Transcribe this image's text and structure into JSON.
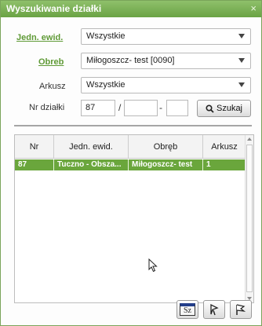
{
  "window": {
    "title": "Wyszukiwanie działki",
    "close_glyph": "×"
  },
  "form": {
    "jedn_label": "Jedn. ewid.",
    "jedn_value": "Wszystkie",
    "obreb_label": "Obreb",
    "obreb_value": "Miłogoszcz- test [0090]",
    "arkusz_label": "Arkusz",
    "arkusz_value": "Wszystkie",
    "nr_label": "Nr działki",
    "nr_value": "87",
    "slash": "/",
    "dash": "-",
    "search_label": "Szukaj"
  },
  "table": {
    "headers": [
      "Nr",
      "Jedn. ewid.",
      "Obręb",
      "Arkusz"
    ],
    "rows": [
      {
        "nr": "87",
        "jedn": "Tuczno - Obsza...",
        "obreb": "Miłogoszcz- test",
        "arkusz": "1"
      }
    ]
  },
  "footer": {
    "sz_label": "Sz"
  },
  "colors": {
    "accent": "#6aa63c",
    "titlebar": "#7ab356",
    "link": "#5f9a36"
  },
  "icons": [
    "close-icon",
    "dropdown-caret-icon",
    "magnifier-icon",
    "sz-icon",
    "pointer-icon",
    "flag-icon",
    "cursor-icon"
  ]
}
